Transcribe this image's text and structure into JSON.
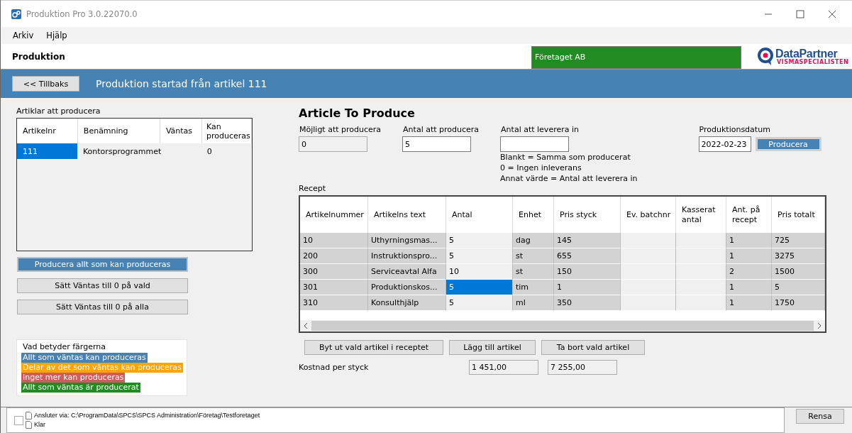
{
  "window": {
    "title": "Produktion Pro 3.0.22070.0"
  },
  "menu": [
    "Arkiv",
    "Hjälp"
  ],
  "header": {
    "title": "Produktion",
    "company": "Företaget AB",
    "logo": {
      "name": "DataPartner",
      "tagline": "VISMASPECIALISTEN"
    }
  },
  "banner": {
    "back_button": "<< Tillbaks",
    "text": "Produktion startad från artikel 111"
  },
  "articles": {
    "label": "Artiklar att producera",
    "columns": [
      "Artikelnr",
      "Benämning",
      "Väntas",
      "Kan produceras"
    ],
    "rows": [
      {
        "cells": [
          "111",
          "Kontorsprogrammet",
          "",
          "0"
        ],
        "selected": true
      }
    ]
  },
  "left_buttons": [
    {
      "label": "Producera allt som kan produceras",
      "kind": "primary"
    },
    {
      "label": "Sätt Väntas till 0 på vald",
      "kind": "normal"
    },
    {
      "label": "Sätt Väntas till 0 på alla",
      "kind": "normal"
    }
  ],
  "legend": {
    "title": "Vad betyder färgerna",
    "items": [
      {
        "label": "Allt som väntas kan produceras",
        "color": "#4682b4"
      },
      {
        "label": "Delar av det som väntas kan produceras",
        "color": "#ffa500"
      },
      {
        "label": "Inget mer kan produceras",
        "color": "#cd5c5c"
      },
      {
        "label": "Allt som väntas är producerat",
        "color": "#228b22"
      }
    ]
  },
  "article_to_produce": {
    "title": "Article To Produce",
    "fields": [
      {
        "label": "Möjligt att producera",
        "value": "0",
        "disabled": true
      },
      {
        "label": "Antal att producera",
        "value": "5",
        "disabled": false
      },
      {
        "label": "Antal att leverera in",
        "disabled": false,
        "hints": [
          "Blankt = Samma som producerat",
          "0 = Ingen inleverans",
          "Annat värde = Antal att leverera in"
        ]
      }
    ],
    "date": {
      "label": "Produktionsdatum",
      "value": "2022-02-23"
    },
    "produce_button": "Producera"
  },
  "recipe": {
    "label": "Recept",
    "columns": [
      {
        "label": "Artikelnummer",
        "editable": false
      },
      {
        "label": "Artikelns text",
        "editable": false
      },
      {
        "label": "Antal",
        "editable": true
      },
      {
        "label": "Enhet",
        "editable": false
      },
      {
        "label": "Pris styck",
        "editable": false
      },
      {
        "label": "Ev. batchnr",
        "editable": true
      },
      {
        "label": "Kasserat antal",
        "editable": true
      },
      {
        "label": "Ant. på recept",
        "editable": false
      },
      {
        "label": "Pris totalt",
        "editable": false
      }
    ],
    "rows": [
      {
        "cells": [
          "10",
          "Uthyrningsmas...",
          "5",
          "dag",
          "145",
          "",
          "",
          "1",
          "725"
        ],
        "selected": false
      },
      {
        "cells": [
          "200",
          "Instruktionspro...",
          "5",
          "st",
          "655",
          "",
          "",
          "1",
          "3275"
        ],
        "selected": false
      },
      {
        "cells": [
          "300",
          "Serviceavtal Alfa",
          "10",
          "st",
          "150",
          "",
          "",
          "2",
          "1500"
        ],
        "selected": false
      },
      {
        "cells": [
          "301",
          "Produktionskos...",
          "5",
          "tim",
          "1",
          "",
          "",
          "1",
          "5"
        ],
        "selected": true
      },
      {
        "cells": [
          "310",
          "Konsulthjälp",
          "5",
          "ml",
          "350",
          "",
          "",
          "1",
          "1750"
        ],
        "selected": false
      }
    ]
  },
  "recipe_buttons": [
    "Byt ut vald artikel i receptet",
    "Lägg till artikel",
    "Ta bort vald artikel"
  ],
  "cost": {
    "label": "Kostnad per styck",
    "values": [
      "1 451,00",
      "7 255,00"
    ]
  },
  "log": {
    "lines": [
      "Ansluter via: C:\\ProgramData\\SPCS\\SPCS Administration\\Företag\\Testforetaget",
      "Klar"
    ],
    "clear_button": "Rensa",
    "checked": false
  }
}
